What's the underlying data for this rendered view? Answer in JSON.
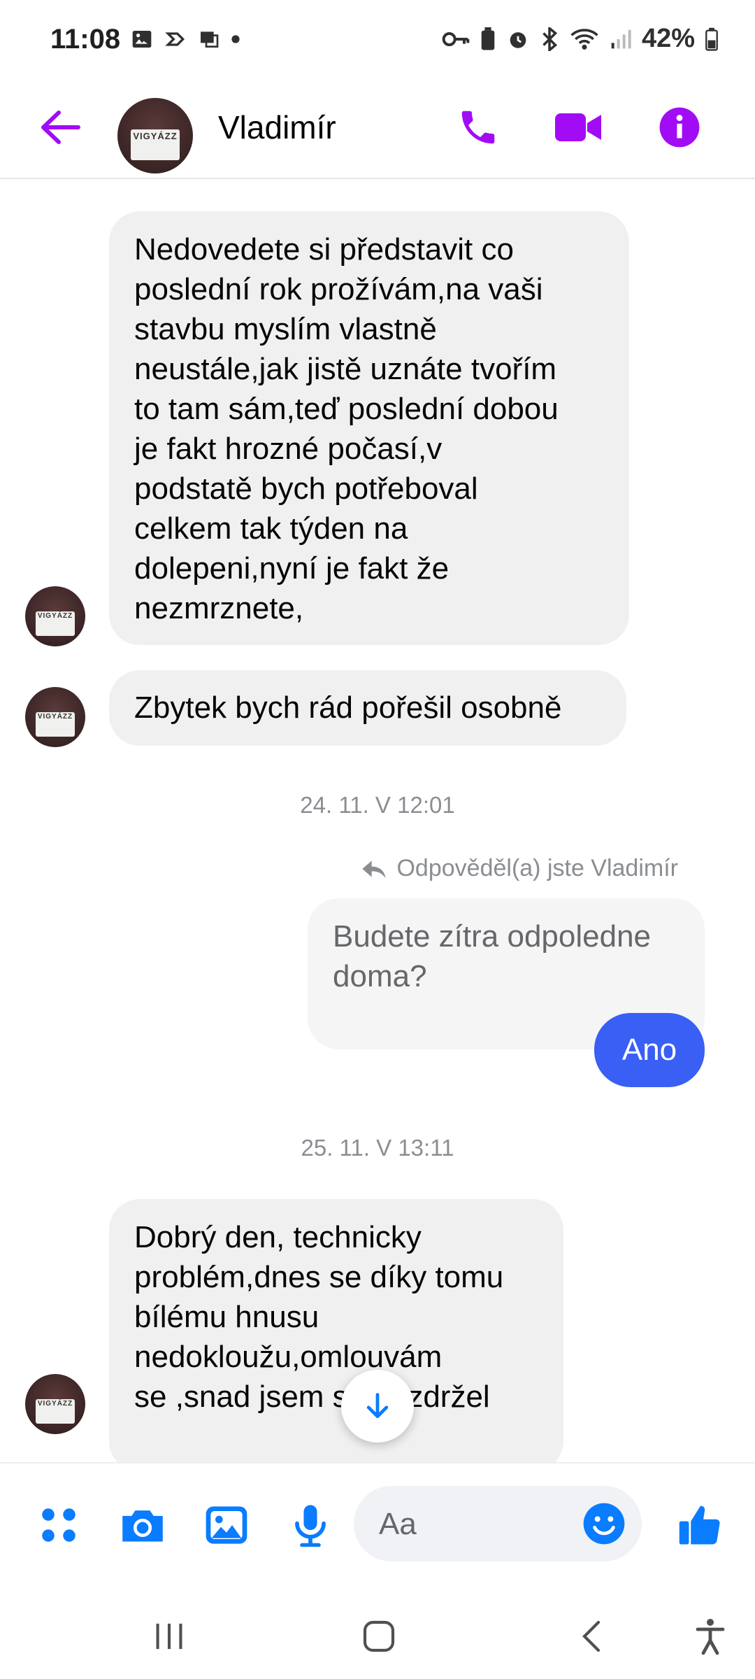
{
  "status_bar": {
    "time": "11:08",
    "battery": "42%",
    "left_icons": [
      "image-icon",
      "sync-icon",
      "device-icon",
      "dot-icon"
    ],
    "right_icons": [
      "key-icon",
      "battery-saver-icon",
      "alarm-icon",
      "bluetooth-icon",
      "wifi-icon",
      "signal-icon",
      "battery-icon"
    ]
  },
  "header": {
    "contact_name": "Vladimír",
    "avatar_text": "VIGYÁZZ",
    "actions": [
      "phone-icon",
      "video-icon",
      "info-icon"
    ],
    "accent_color": "#a20cf5"
  },
  "messages": {
    "msg1": "Nedovedete si představit co\nposlední rok prožívám,na vaši\nstavbu myslím vlastně\nneustále,jak jistě uznáte tvořím\nto tam sám,teď poslední dobou\nje fakt hrozné počasí,v\npodstatě bych potřeboval\ncelkem tak týden na\ndolepeni,nyní je fakt že\nnezmrznete,",
    "msg2": "Zbytek bych rád pořešil osobně",
    "timestamp1": "24. 11. V 12:01",
    "reply_note": "Odpověděl(a) jste Vladimír",
    "quoted": "Budete zítra odpoledne\ndoma?",
    "out_msg": "Ano",
    "timestamp2": "25. 11. V 13:11",
    "msg3": "Dobrý den, technicky\nproblém,dnes se díky tomu\nbílému hnusu\nnedokloužu,omlouvám\nse ,snad jsem se nezdržel"
  },
  "composer": {
    "placeholder": "Aa",
    "buttons": [
      "apps-icon",
      "camera-icon",
      "gallery-icon",
      "microphone-icon",
      "emoji-icon",
      "thumbs-up-icon"
    ],
    "accent_color": "#0a7cff"
  },
  "nav": [
    "recent-apps-icon",
    "home-icon",
    "back-icon",
    "accessibility-icon"
  ],
  "colors": {
    "incoming_bubble": "#f0f0f0",
    "outgoing_bubble": "#3a5ff5",
    "timestamp": "#8a8d91"
  }
}
